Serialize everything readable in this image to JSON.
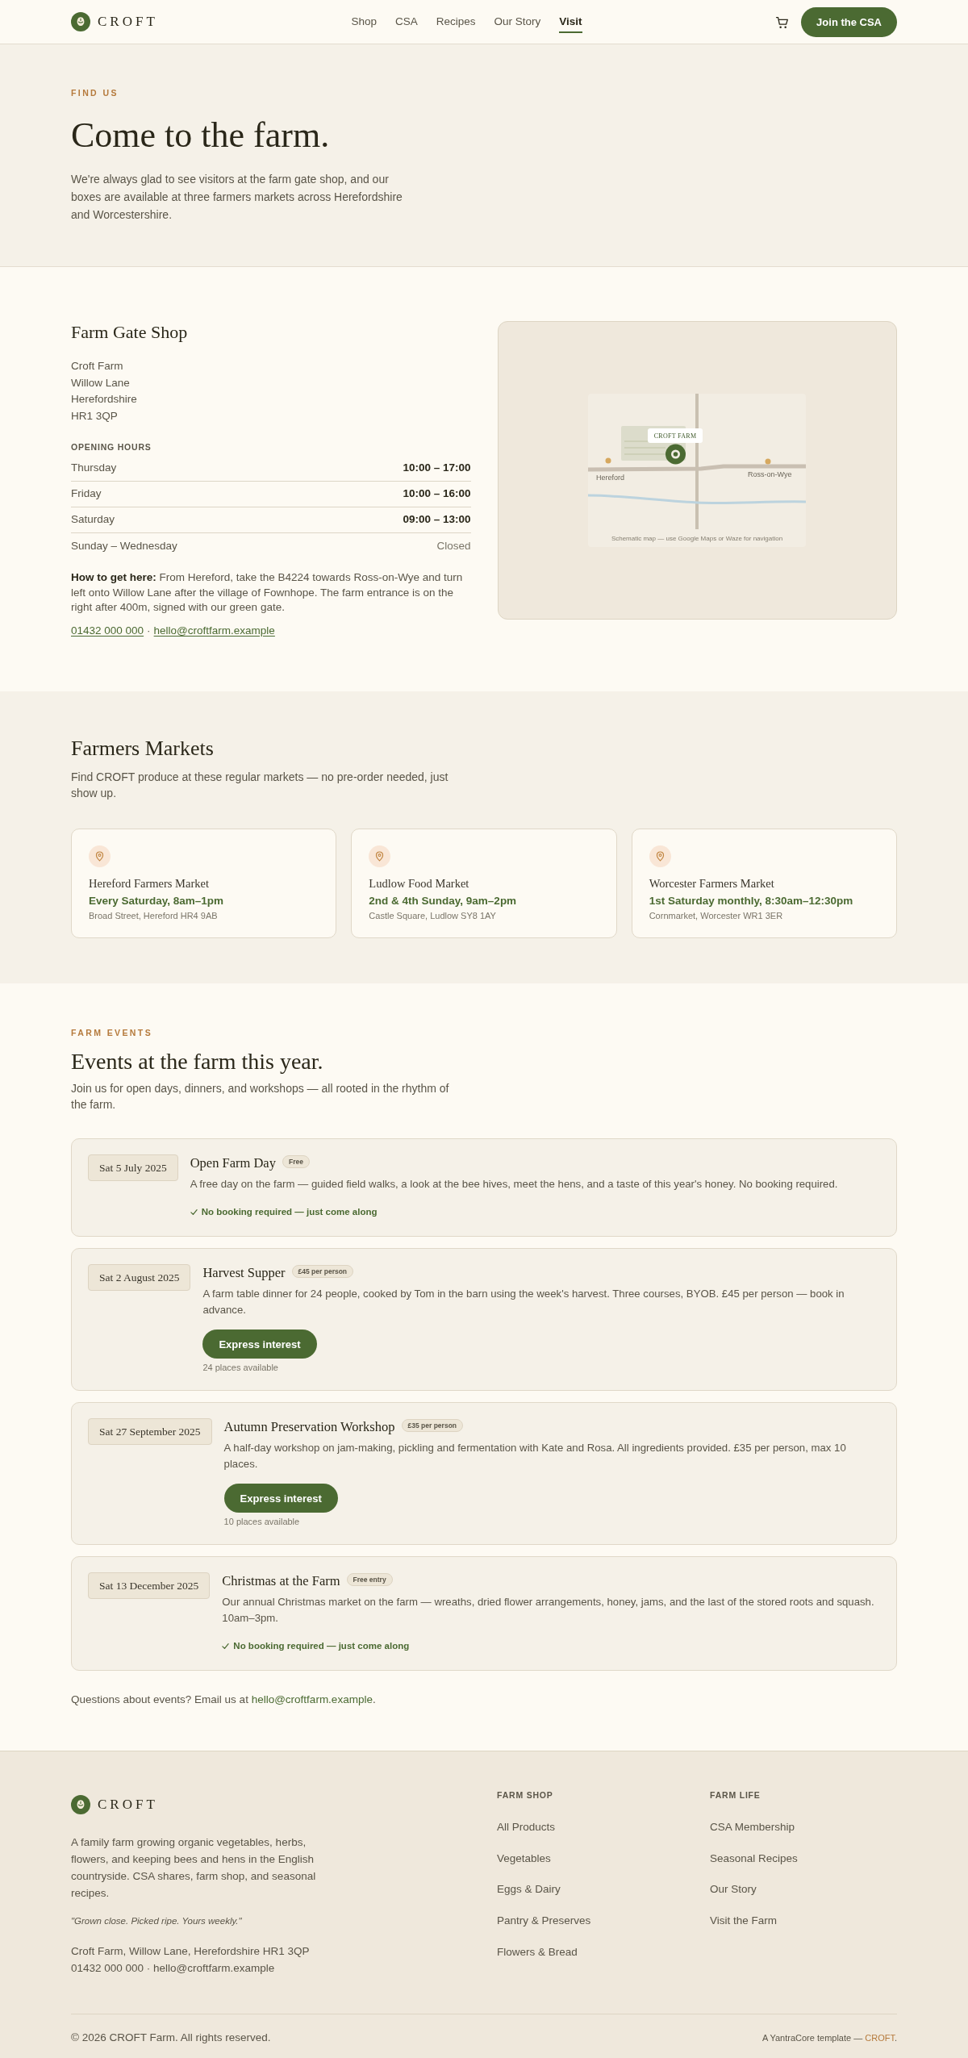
{
  "header": {
    "logo": "CROFT",
    "nav": [
      {
        "label": "Shop",
        "selected": false
      },
      {
        "label": "CSA",
        "selected": false
      },
      {
        "label": "Recipes",
        "selected": false
      },
      {
        "label": "Our Story",
        "selected": false
      },
      {
        "label": "Visit",
        "selected": true
      }
    ],
    "cta": "Join the CSA"
  },
  "hero": {
    "eyebrow": "FIND US",
    "title": "Come to the farm.",
    "intro": "We're always glad to see visitors at the farm gate shop, and our boxes are available at three farmers markets across Herefordshire and Worcestershire."
  },
  "shop": {
    "title": "Farm Gate Shop",
    "address": [
      "Croft Farm",
      "Willow Lane",
      "Herefordshire",
      "HR1 3QP"
    ],
    "hours_label": "OPENING HOURS",
    "hours": [
      {
        "day": "Thursday",
        "time": "10:00 – 17:00",
        "closed": false
      },
      {
        "day": "Friday",
        "time": "10:00 – 16:00",
        "closed": false
      },
      {
        "day": "Saturday",
        "time": "09:00 – 13:00",
        "closed": false
      },
      {
        "day": "Sunday – Wednesday",
        "time": "Closed",
        "closed": true
      }
    ],
    "directions": "**How to get here:** From Hereford, take the B4224 towards Ross-on-Wye and turn left onto Willow Lane after the village of Fownhope. The farm entrance is on the right after 400m, signed with our green gate.",
    "phone": "01432 000 000",
    "separator": "·",
    "email": "hello@croftfarm.example",
    "map": {
      "farm_label": "CROFT FARM",
      "towns": [
        "Hereford",
        "Ross-on-Wye"
      ],
      "caption": "Schematic map — use Google Maps or Waze for navigation"
    }
  },
  "markets": {
    "title": "Farmers Markets",
    "intro": "Find CROFT produce at these regular markets — no pre-order needed, just show up.",
    "items": [
      {
        "name": "Hereford Farmers Market",
        "schedule": "Every Saturday, 8am–1pm",
        "address": "Broad Street, Hereford HR4 9AB"
      },
      {
        "name": "Ludlow Food Market",
        "schedule": "2nd & 4th Sunday, 9am–2pm",
        "address": "Castle Square, Ludlow SY8 1AY"
      },
      {
        "name": "Worcester Farmers Market",
        "schedule": "1st Saturday monthly, 8:30am–12:30pm",
        "address": "Cornmarket, Worcester WR1 3ER"
      }
    ]
  },
  "events": {
    "eyebrow": "FARM EVENTS",
    "title": "Events at the farm this year.",
    "intro": "Join us for open days, dinners, and workshops — all rooted in the rhythm of the farm.",
    "items": [
      {
        "kind": "drop_in",
        "date": "Sat 5 July 2025",
        "title": "Open Farm Day",
        "price": "Free",
        "description": "A free day on the farm — guided field walks, a look at the bee hives, meet the hens, and a taste of this year's honey. No booking required.",
        "note": "No booking required — just come along"
      },
      {
        "kind": "booking",
        "date": "Sat 2 August 2025",
        "title": "Harvest Supper",
        "price": "£45 per person",
        "description": "A farm table dinner for 24 people, cooked by Tom in the barn using the week's harvest. Three courses, BYOB. £45 per person — book in advance.",
        "action": "Express interest",
        "places": "24 places available"
      },
      {
        "kind": "booking",
        "date": "Sat 27 September 2025",
        "title": "Autumn Preservation Workshop",
        "price": "£35 per person",
        "description": "A half-day workshop on jam-making, pickling and fermentation with Kate and Rosa. All ingredients provided. £35 per person, max 10 places.",
        "action": "Express interest",
        "places": "10 places available"
      },
      {
        "kind": "drop_in",
        "date": "Sat 13 December 2025",
        "title": "Christmas at the Farm",
        "price": "Free entry",
        "description": "Our annual Christmas market on the farm — wreaths, dried flower arrangements, honey, jams, and the last of the stored roots and squash. 10am–3pm.",
        "note": "No booking required — just come along"
      }
    ],
    "contact": {
      "text": "Questions about events? Email us at",
      "email": "hello@croftfarm.example",
      "end": "."
    }
  },
  "footer": {
    "logo": "CROFT",
    "description": "A family farm growing organic vegetables, herbs, flowers, and keeping bees and hens in the English countryside. CSA shares, farm shop, and seasonal recipes.",
    "tagline": "\"Grown close. Picked ripe. Yours weekly.\"",
    "address": "Croft Farm, Willow Lane, Herefordshire HR1 3QP",
    "contact": "01432 000 000 · hello@croftfarm.example",
    "columns": [
      {
        "title": "FARM SHOP",
        "links": [
          "All Products",
          "Vegetables",
          "Eggs & Dairy",
          "Pantry & Preserves",
          "Flowers & Bread"
        ]
      },
      {
        "title": "FARM LIFE",
        "links": [
          "CSA Membership",
          "Seasonal Recipes",
          "Our Story",
          "Visit the Farm"
        ]
      }
    ],
    "copyright": "© 2026 CROFT Farm. All rights reserved.",
    "credit": {
      "text": "A YantraCore template —",
      "link": "CROFT",
      "end": "."
    }
  }
}
